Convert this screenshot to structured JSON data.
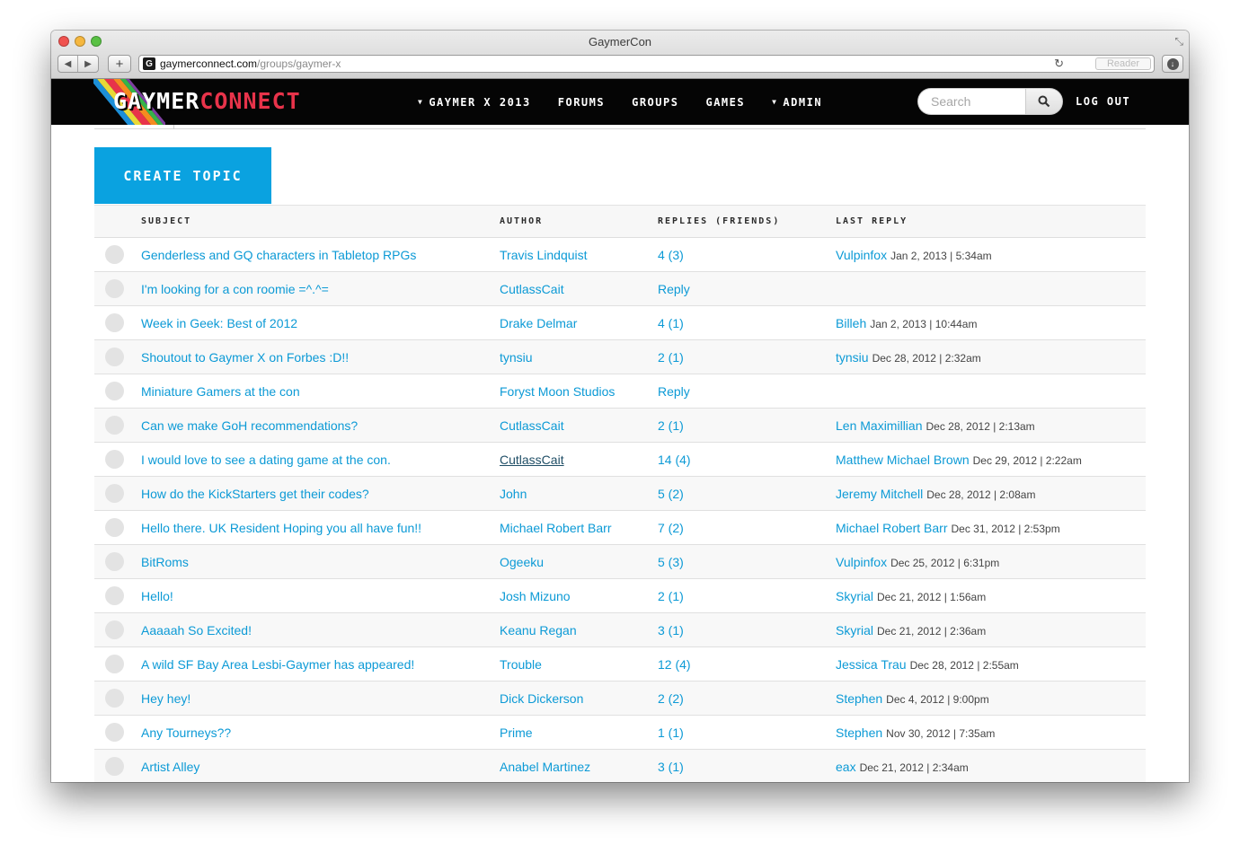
{
  "window": {
    "title": "GaymerCon",
    "url_host": "gaymerconnect.com",
    "url_path": "/groups/gaymer-x",
    "reader_label": "Reader",
    "favicon_letter": "G"
  },
  "site": {
    "logo_part1": "GAYMER",
    "logo_part2": "CONNECT",
    "nav": [
      {
        "label": "GAYMER X 2013",
        "dropdown": true
      },
      {
        "label": "FORUMS",
        "dropdown": false
      },
      {
        "label": "GROUPS",
        "dropdown": false
      },
      {
        "label": "GAMES",
        "dropdown": false
      },
      {
        "label": "ADMIN",
        "dropdown": true
      }
    ],
    "search_placeholder": "Search",
    "logout_label": "LOG OUT",
    "colors": {
      "accent": "#0aa2e0",
      "logo_red": "#e8334a",
      "bar": "#050505"
    }
  },
  "forum": {
    "create_topic_label": "CREATE TOPIC",
    "headers": {
      "subject": "SUBJECT",
      "author": "AUTHOR",
      "replies": "REPLIES (FRIENDS)",
      "last_reply": "LAST REPLY"
    },
    "topics": [
      {
        "subject": "Genderless and GQ characters in Tabletop RPGs",
        "author": "Travis Lindquist",
        "replies": "4 (3)",
        "last_by": "Vulpinfox",
        "last_time": "Jan 2, 2013 | 5:34am"
      },
      {
        "subject": "I'm looking for a con roomie =^.^=",
        "author": "CutlassCait",
        "replies": "Reply",
        "last_by": "",
        "last_time": ""
      },
      {
        "subject": "Week in Geek: Best of 2012",
        "author": "Drake Delmar",
        "replies": "4 (1)",
        "last_by": "Billeh",
        "last_time": "Jan 2, 2013 | 10:44am"
      },
      {
        "subject": "Shoutout to Gaymer X on Forbes :D!!",
        "author": "tynsiu",
        "replies": "2 (1)",
        "last_by": "tynsiu",
        "last_time": "Dec 28, 2012 | 2:32am"
      },
      {
        "subject": "Miniature Gamers at the con",
        "author": "Foryst Moon Studios",
        "replies": "Reply",
        "last_by": "",
        "last_time": ""
      },
      {
        "subject": "Can we make GoH recommendations?",
        "author": "CutlassCait",
        "replies": "2 (1)",
        "last_by": "Len Maximillian",
        "last_time": "Dec 28, 2012 | 2:13am"
      },
      {
        "subject": "I would love to see a dating game at the con.",
        "author": "CutlassCait",
        "replies": "14 (4)",
        "last_by": "Matthew Michael Brown",
        "last_time": "Dec 29, 2012 | 2:22am",
        "author_hovered": true
      },
      {
        "subject": "How do the KickStarters get their codes?",
        "author": "John",
        "replies": "5 (2)",
        "last_by": "Jeremy Mitchell",
        "last_time": "Dec 28, 2012 | 2:08am"
      },
      {
        "subject": "Hello there. UK Resident Hoping you all have fun!!",
        "author": "Michael Robert Barr",
        "replies": "7 (2)",
        "last_by": "Michael Robert Barr",
        "last_time": "Dec 31, 2012 | 2:53pm"
      },
      {
        "subject": "BitRoms",
        "author": "Ogeeku",
        "replies": "5 (3)",
        "last_by": "Vulpinfox",
        "last_time": "Dec 25, 2012 | 6:31pm"
      },
      {
        "subject": "Hello!",
        "author": "Josh Mizuno",
        "replies": "2 (1)",
        "last_by": "Skyrial",
        "last_time": "Dec 21, 2012 | 1:56am"
      },
      {
        "subject": "Aaaaah So Excited!",
        "author": "Keanu Regan",
        "replies": "3 (1)",
        "last_by": "Skyrial",
        "last_time": "Dec 21, 2012 | 2:36am"
      },
      {
        "subject": "A wild SF Bay Area Lesbi-Gaymer has appeared!",
        "author": "Trouble",
        "replies": "12 (4)",
        "last_by": "Jessica Trau",
        "last_time": "Dec 28, 2012 | 2:55am"
      },
      {
        "subject": "Hey hey!",
        "author": "Dick Dickerson",
        "replies": "2 (2)",
        "last_by": "Stephen",
        "last_time": "Dec 4, 2012 | 9:00pm"
      },
      {
        "subject": "Any Tourneys??",
        "author": "Prime",
        "replies": "1 (1)",
        "last_by": "Stephen",
        "last_time": "Nov 30, 2012 | 7:35am"
      },
      {
        "subject": "Artist Alley",
        "author": "Anabel Martinez",
        "replies": "3 (1)",
        "last_by": "eax",
        "last_time": "Dec 21, 2012 | 2:34am"
      }
    ]
  }
}
